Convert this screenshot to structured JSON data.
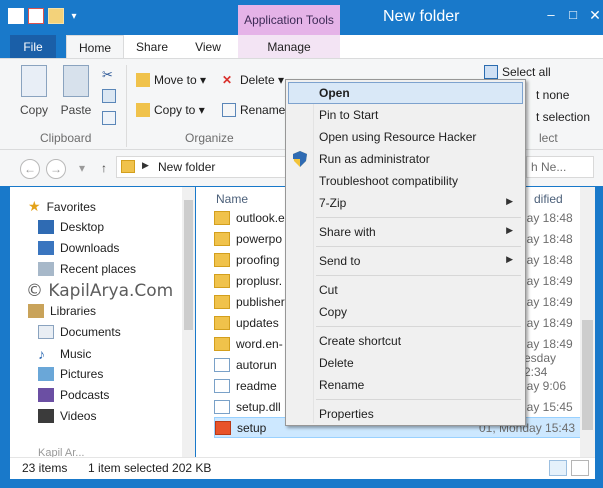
{
  "window": {
    "title": "New folder",
    "contextual_tab_group": "Application Tools"
  },
  "window_controls": {
    "minimize": "–",
    "maximize": "□",
    "close": "✕"
  },
  "ribbon_tabs": {
    "file": "File",
    "home": "Home",
    "share": "Share",
    "view": "View",
    "manage": "Manage"
  },
  "ribbon": {
    "copy": "Copy",
    "paste": "Paste",
    "move_to": "Move to ▾",
    "copy_to": "Copy to ▾",
    "delete": "Delete ▾",
    "rename": "Rename",
    "select_all": "Select all",
    "select_none": "t none",
    "invert_selection": "t selection",
    "group_clipboard": "Clipboard",
    "group_organize": "Organize",
    "group_select": "lect"
  },
  "address": {
    "path": "New folder",
    "search_placeholder": "h Ne..."
  },
  "nav_pane": {
    "favorites": "Favorites",
    "desktop": "Desktop",
    "downloads": "Downloads",
    "recent_places": "Recent places",
    "libraries": "Libraries",
    "documents": "Documents",
    "music": "Music",
    "pictures": "Pictures",
    "podcasts": "Podcasts",
    "videos": "Videos",
    "truncated": "Kapil Ar..."
  },
  "watermark": "© KapilArya.Com",
  "columns": {
    "name": "Name",
    "date_modified": "dified"
  },
  "files": [
    {
      "name": "outlook.e",
      "date": "lay 18:48",
      "type": "folder"
    },
    {
      "name": "powerpo",
      "date": "lay 18:48",
      "type": "folder"
    },
    {
      "name": "proofing",
      "date": "lay 18:48",
      "type": "folder"
    },
    {
      "name": "proplusr.",
      "date": "lay 18:49",
      "type": "folder"
    },
    {
      "name": "publisher",
      "date": "lay 18:49",
      "type": "folder"
    },
    {
      "name": "updates",
      "date": "lay 18:49",
      "type": "folder"
    },
    {
      "name": "word.en-",
      "date": "lay 18:49",
      "type": "folder"
    },
    {
      "name": "autorun",
      "date": "esday 2:34",
      "type": "app"
    },
    {
      "name": "readme",
      "date": "lay 9:06",
      "type": "app"
    },
    {
      "name": "setup.dll",
      "date": "lay 15:45",
      "type": "app"
    },
    {
      "name": "setup",
      "date": "01, Monday 15:43",
      "type": "office"
    }
  ],
  "status": {
    "items": "23 items",
    "selected": "1 item selected  202 KB"
  },
  "context_menu": {
    "open": "Open",
    "pin_to_start": "Pin to Start",
    "open_resource_hacker": "Open using Resource Hacker",
    "run_as_admin": "Run as administrator",
    "troubleshoot": "Troubleshoot compatibility",
    "seven_zip": "7-Zip",
    "share_with": "Share with",
    "send_to": "Send to",
    "cut": "Cut",
    "copy": "Copy",
    "create_shortcut": "Create shortcut",
    "delete": "Delete",
    "rename": "Rename",
    "properties": "Properties"
  },
  "colors": {
    "titlebar": "#1979ca",
    "contextual_tab": "#e5b3e8",
    "selection": "#cde8ff",
    "menu_highlight": "#d9e8f7"
  }
}
